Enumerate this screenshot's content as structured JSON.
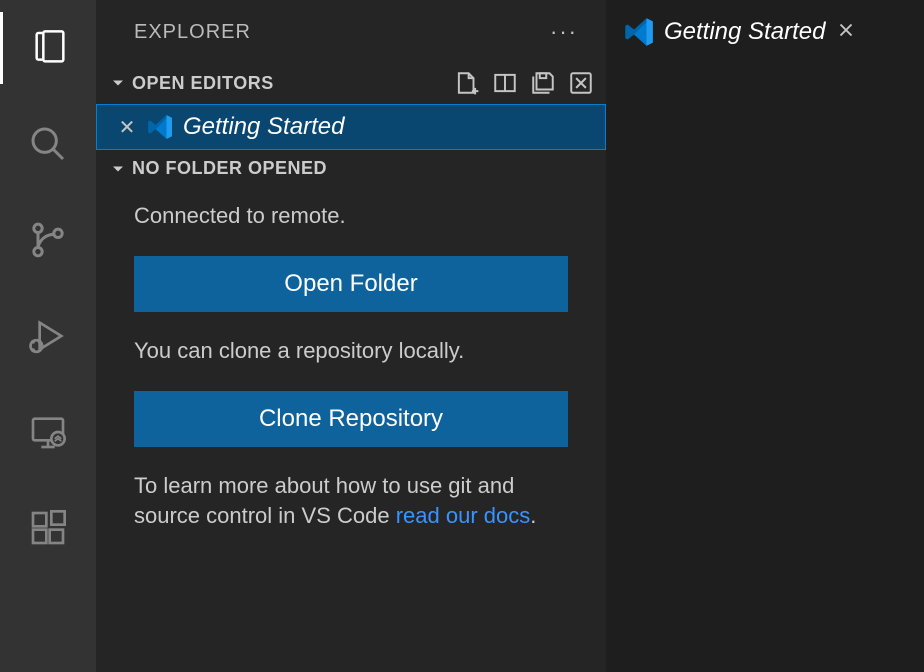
{
  "sidebar": {
    "title": "EXPLORER",
    "sections": {
      "openEditors": {
        "label": "OPEN EDITORS",
        "items": [
          {
            "label": "Getting Started"
          }
        ]
      },
      "noFolder": {
        "label": "NO FOLDER OPENED",
        "connectedText": "Connected to remote.",
        "openFolderButton": "Open Folder",
        "cloneText": "You can clone a repository locally.",
        "cloneButton": "Clone Repository",
        "learnTextPrefix": "To learn more about how to use git and source control in VS Code ",
        "learnLink": "read our docs",
        "learnTextSuffix": "."
      }
    }
  },
  "editor": {
    "tabs": [
      {
        "label": "Getting Started"
      }
    ]
  }
}
